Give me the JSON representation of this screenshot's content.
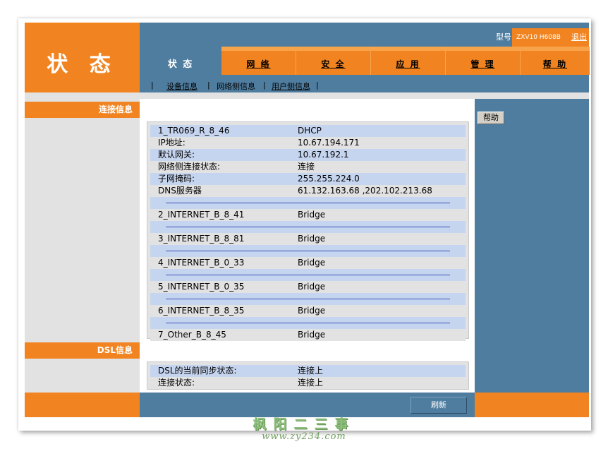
{
  "header": {
    "logo": "状 态",
    "model_label": "型号",
    "model_value": "ZXV10 H608B",
    "logout": "退出"
  },
  "tabs": [
    {
      "label": "状 态",
      "active": true
    },
    {
      "label": "网 络"
    },
    {
      "label": "安 全"
    },
    {
      "label": "应 用"
    },
    {
      "label": "管 理"
    },
    {
      "label": "帮 助"
    }
  ],
  "subnav": {
    "sep": "|",
    "items": [
      "设备信息",
      "网络侧信息",
      "用户侧信息"
    ]
  },
  "sidebar": {
    "section1": "连接信息",
    "section2": "DSL信息"
  },
  "help_button": "帮助",
  "connection_rows": [
    {
      "k": "1_TR069_R_8_46",
      "v": "DHCP"
    },
    {
      "k": "IP地址:",
      "v": "10.67.194.171"
    },
    {
      "k": "默认网关:",
      "v": "10.67.192.1"
    },
    {
      "k": "网络侧连接状态:",
      "v": "连接"
    },
    {
      "k": "子网掩码:",
      "v": "255.255.224.0"
    },
    {
      "k": "DNS服务器",
      "v": "61.132.163.68 ,202.102.213.68"
    },
    {
      "k": "",
      "v": ""
    },
    {
      "k": "2_INTERNET_B_8_41",
      "v": "Bridge"
    },
    {
      "k": "",
      "v": ""
    },
    {
      "k": "3_INTERNET_B_8_81",
      "v": "Bridge"
    },
    {
      "k": "",
      "v": ""
    },
    {
      "k": "4_INTERNET_B_0_33",
      "v": "Bridge"
    },
    {
      "k": "",
      "v": ""
    },
    {
      "k": "5_INTERNET_B_0_35",
      "v": "Bridge"
    },
    {
      "k": "",
      "v": ""
    },
    {
      "k": "6_INTERNET_B_8_35",
      "v": "Bridge"
    },
    {
      "k": "",
      "v": ""
    },
    {
      "k": "7_Other_B_8_45",
      "v": "Bridge"
    }
  ],
  "dsl_rows": [
    {
      "k": "DSL的当前同步状态:",
      "v": "连接上"
    },
    {
      "k": "连接状态:",
      "v": "连接上"
    }
  ],
  "footer": {
    "refresh": "刷新"
  },
  "watermark": {
    "line1": "枫阳二三事",
    "line2": "www.zy234.com"
  }
}
